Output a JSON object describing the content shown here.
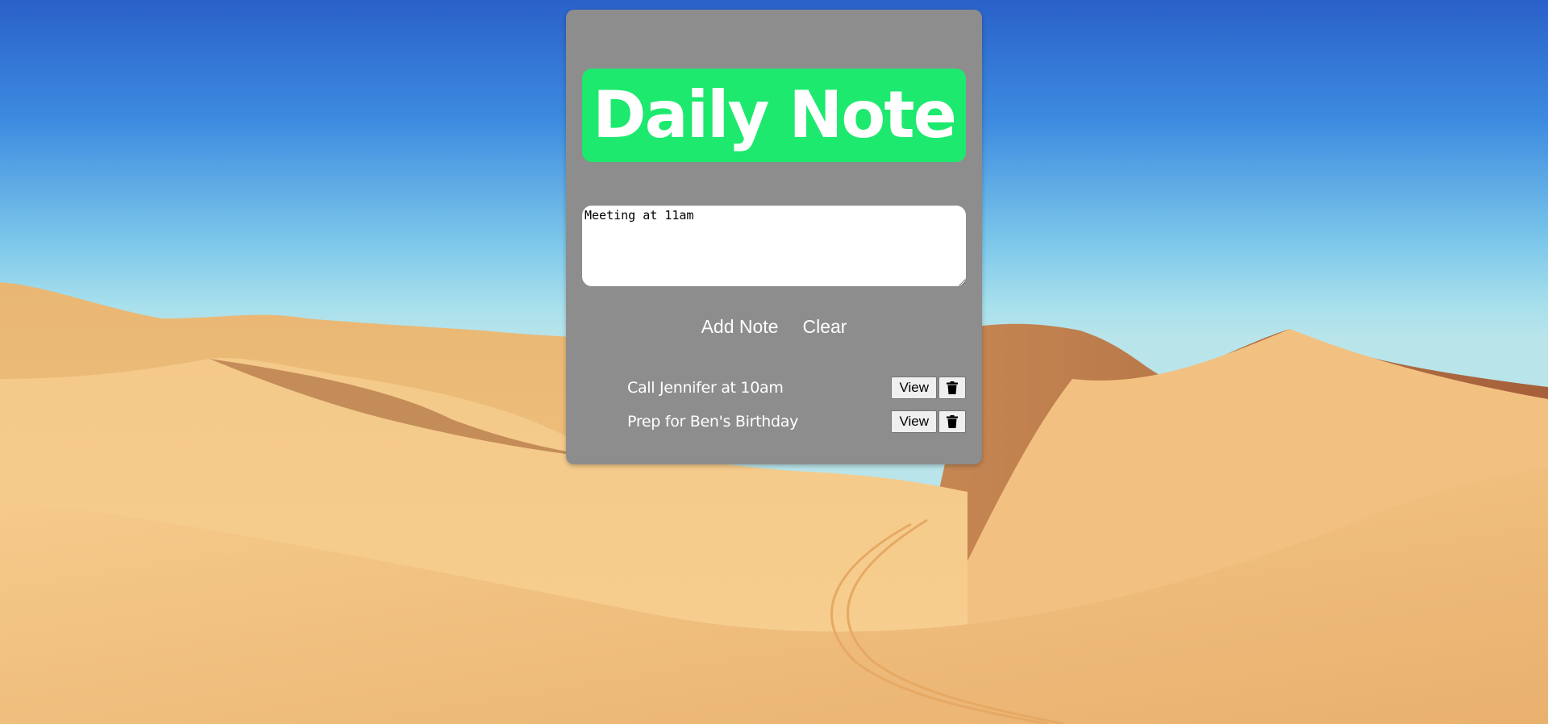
{
  "app": {
    "title": "Daily Note"
  },
  "editor": {
    "value": "Meeting at 11am"
  },
  "actions": {
    "add_label": "Add Note",
    "clear_label": "Clear"
  },
  "notes": [
    {
      "text": "Call Jennifer at 10am",
      "view_label": "View",
      "delete_icon": "trash-icon"
    },
    {
      "text": "Prep for Ben's Birthday",
      "view_label": "View",
      "delete_icon": "trash-icon"
    }
  ],
  "colors": {
    "card": "#8d8d8d",
    "title_bg": "#1de96e",
    "title_text": "#ffffff",
    "note_text": "#ffffff"
  }
}
